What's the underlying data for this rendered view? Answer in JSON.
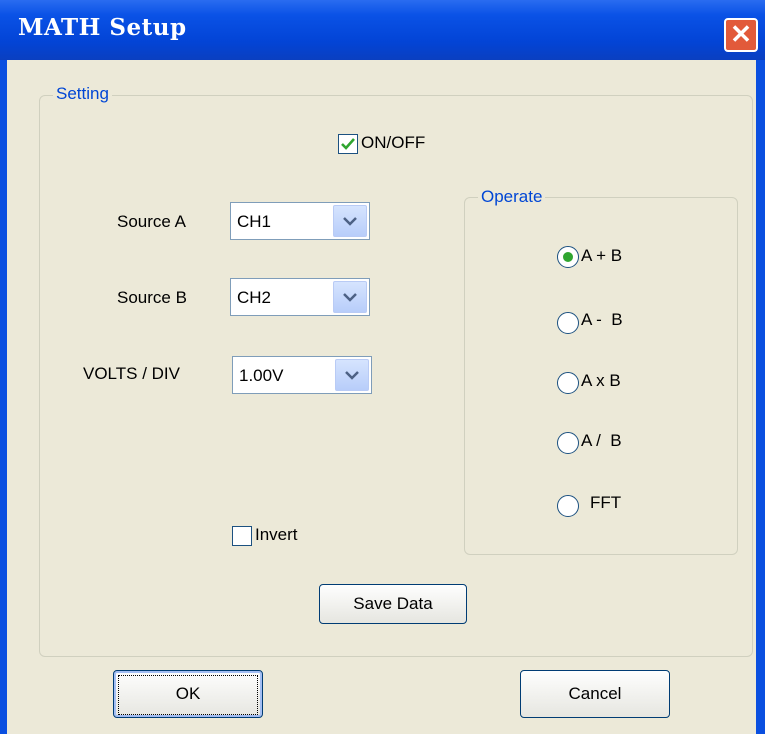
{
  "window": {
    "title": "MATH Setup",
    "close_symbol": "✕"
  },
  "setting": {
    "legend": "Setting",
    "onoff": {
      "label": "ON/OFF",
      "checked": true
    },
    "source_a": {
      "label": "Source A",
      "value": "CH1"
    },
    "source_b": {
      "label": "Source B",
      "value": "CH2"
    },
    "volts_div": {
      "label": "VOLTS / DIV",
      "value": "1.00V"
    },
    "invert": {
      "label": "Invert",
      "checked": false
    },
    "save_label": "Save Data"
  },
  "operate": {
    "legend": "Operate",
    "options": [
      {
        "label": "A + B",
        "selected": true
      },
      {
        "label": "A -  B",
        "selected": false
      },
      {
        "label": "A x B",
        "selected": false
      },
      {
        "label": "A /  B",
        "selected": false
      },
      {
        "label": "FFT",
        "selected": false
      }
    ]
  },
  "footer": {
    "ok_label": "OK",
    "cancel_label": "Cancel"
  },
  "colors": {
    "title_bar": "#0a52e6",
    "face": "#ece9d8",
    "legend_text": "#0046d5",
    "close": "#e25a3a",
    "check": "#2fa52f"
  }
}
